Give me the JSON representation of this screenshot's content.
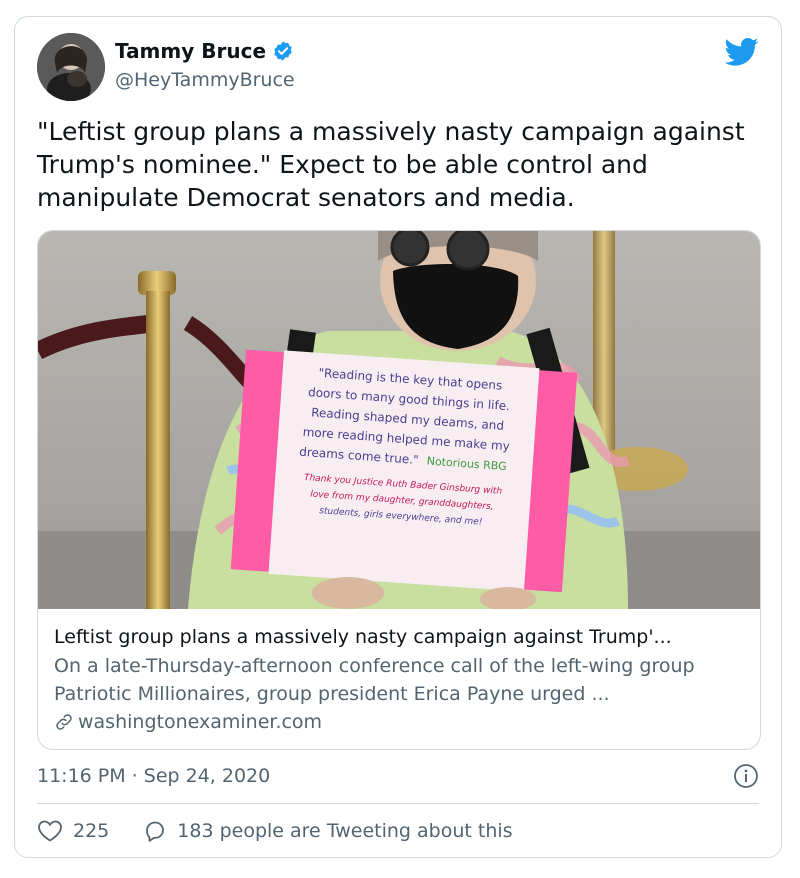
{
  "author": {
    "name": "Tammy Bruce",
    "handle": "@HeyTammyBruce",
    "verified": true
  },
  "tweet": {
    "text": "\"Leftist group plans a massively nasty campaign against Trump's nominee.\" Expect to be able control and manipulate Democrat senators and media.",
    "timestamp": "11:16 PM · Sep 24, 2020"
  },
  "link_card": {
    "title": "Leftist group plans a massively nasty campaign against Trump'...",
    "description": "On a late-Thursday-afternoon conference call of the left-wing group Patriotic Millionaires, group president Erica Payne urged ...",
    "domain": "washingtonexaminer.com",
    "sign": {
      "line1": "\"Reading is the key that opens",
      "line2": "doors to many good things in life.",
      "line3": "Reading shaped my deams, and",
      "line4": "more reading helped me make my",
      "line5": "dreams come true.\"",
      "attribution": "Notorious RBG",
      "thanks1": "Thank you Justice Ruth Bader Ginsburg with",
      "thanks2": "love from my daughter, granddaughters,",
      "thanks3": "students, girls everywhere, and me!"
    }
  },
  "actions": {
    "likes": "225",
    "replies_text": "183 people are Tweeting about this"
  },
  "colors": {
    "twitter_blue": "#1d9bf0",
    "secondary_text": "#536471",
    "border": "#cfd9de",
    "sign_pink": "#ff5ca8"
  },
  "icons": [
    "verified-badge-icon",
    "twitter-bird-icon",
    "link-icon",
    "info-icon",
    "heart-icon",
    "reply-bubble-icon"
  ]
}
